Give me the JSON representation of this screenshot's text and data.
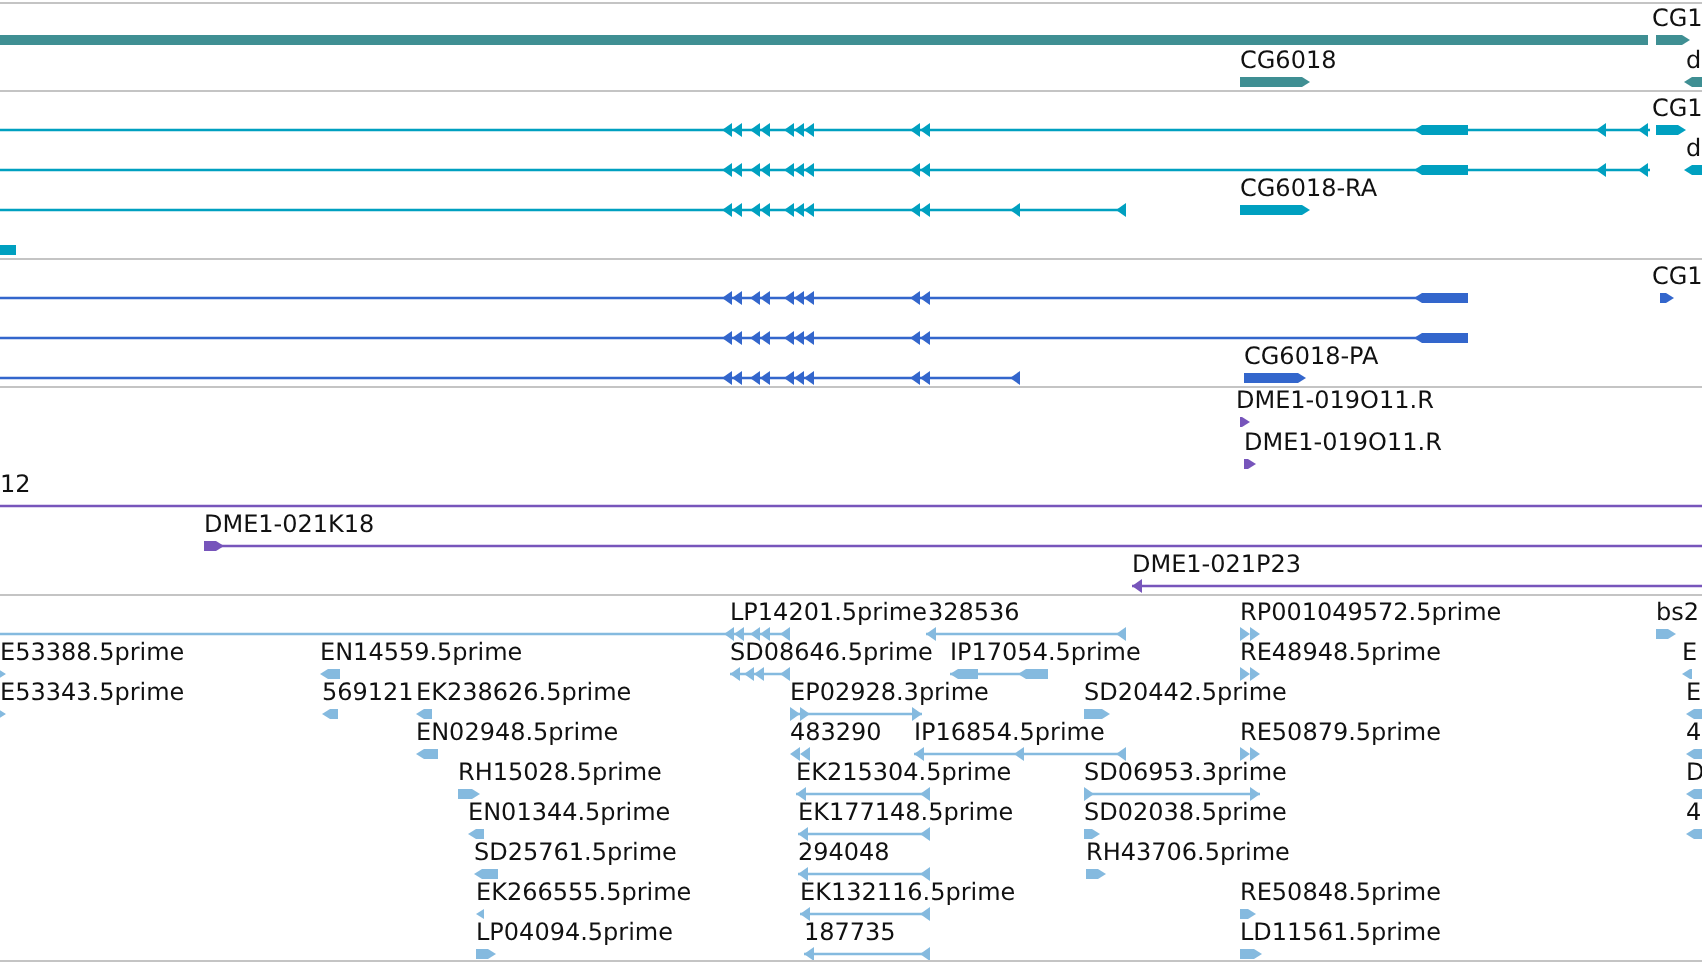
{
  "tracks": [
    {
      "kind": "gene",
      "features": [
        {
          "label": "CG1",
          "reverse": false
        },
        {
          "label": "CG6018",
          "reverse": false
        },
        {
          "label": "d",
          "reverse": true
        }
      ]
    },
    {
      "kind": "mrna",
      "features": [
        {
          "label": "CG1",
          "reverse": false
        },
        {
          "label": "d",
          "reverse": true
        },
        {
          "label": "CG6018-RA",
          "reverse": false
        }
      ]
    },
    {
      "kind": "cds",
      "features": [
        {
          "label": "CG1",
          "reverse": false
        },
        {
          "label": "CG6018-PA",
          "reverse": false
        }
      ]
    },
    {
      "kind": "clone",
      "features": [
        {
          "label": "DME1-019O11.R",
          "reverse": false
        },
        {
          "label": "DME1-019O11.R",
          "reverse": false
        },
        {
          "label": "12"
        },
        {
          "label": "DME1-021K18",
          "reverse": false
        },
        {
          "label": "DME1-021P23",
          "reverse": true
        }
      ]
    },
    {
      "kind": "est",
      "features": [
        {
          "label": "LP14201.5prime",
          "reverse": true
        },
        {
          "label": "328536",
          "reverse": true
        },
        {
          "label": "RP001049572.5prime",
          "reverse": false
        },
        {
          "label": "bs2",
          "reverse": false
        },
        {
          "label": "E53388.5prime",
          "reverse": false
        },
        {
          "label": "EN14559.5prime",
          "reverse": true
        },
        {
          "label": "SD08646.5prime",
          "reverse": true
        },
        {
          "label": "IP17054.5prime",
          "reverse": true
        },
        {
          "label": "RE48948.5prime",
          "reverse": false
        },
        {
          "label": "E",
          "reverse": true
        },
        {
          "label": "E53343.5prime",
          "reverse": false
        },
        {
          "label": "569121",
          "reverse": true
        },
        {
          "label": "EK238626.5prime",
          "reverse": true
        },
        {
          "label": "EP02928.3prime",
          "reverse": false
        },
        {
          "label": "SD20442.5prime",
          "reverse": false
        },
        {
          "label": "E",
          "reverse": true
        },
        {
          "label": "EN02948.5prime",
          "reverse": true
        },
        {
          "label": "483290",
          "reverse": true
        },
        {
          "label": "IP16854.5prime",
          "reverse": true
        },
        {
          "label": "RE50879.5prime",
          "reverse": false
        },
        {
          "label": "4",
          "reverse": true
        },
        {
          "label": "RH15028.5prime",
          "reverse": false
        },
        {
          "label": "EK215304.5prime",
          "reverse": true
        },
        {
          "label": "SD06953.3prime",
          "reverse": false
        },
        {
          "label": "D",
          "reverse": true
        },
        {
          "label": "EN01344.5prime",
          "reverse": true
        },
        {
          "label": "EK177148.5prime",
          "reverse": true
        },
        {
          "label": "SD02038.5prime",
          "reverse": false
        },
        {
          "label": "4",
          "reverse": true
        },
        {
          "label": "SD25761.5prime",
          "reverse": true
        },
        {
          "label": "294048",
          "reverse": true
        },
        {
          "label": "RH43706.5prime",
          "reverse": false
        },
        {
          "label": "EK266555.5prime",
          "reverse": true
        },
        {
          "label": "EK132116.5prime",
          "reverse": true
        },
        {
          "label": "RE50848.5prime",
          "reverse": false
        },
        {
          "label": "LP04094.5prime",
          "reverse": false
        },
        {
          "label": "187735",
          "reverse": true
        },
        {
          "label": "LD11561.5prime",
          "reverse": false
        }
      ]
    }
  ]
}
